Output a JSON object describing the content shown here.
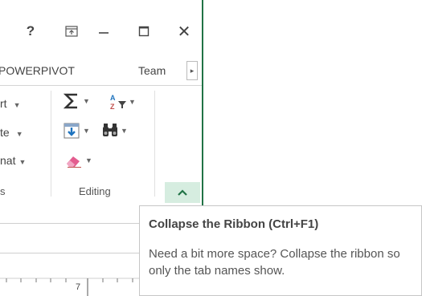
{
  "titlebar": {
    "help_label": "?",
    "close_label": "✕"
  },
  "tabs": {
    "powerpivot": "POWERPIVOT",
    "team": "Team",
    "scroll_right": "▸"
  },
  "cells_group": {
    "insert_partial": "rt",
    "delete_partial": "te",
    "format_partial": "nat",
    "label_partial": "s"
  },
  "editing_group": {
    "label": "Editing",
    "icons": [
      "autosum-icon",
      "sort-filter-icon",
      "fill-icon",
      "find-select-icon",
      "clear-icon"
    ]
  },
  "sheet": {
    "ruler_number": "7"
  },
  "tooltip": {
    "title": "Collapse the Ribbon (Ctrl+F1)",
    "body": "Need a bit more space? Collapse the ribbon so only the tab names show."
  },
  "colors": {
    "accent": "#217346",
    "collapse_bg": "#d6ede0"
  }
}
